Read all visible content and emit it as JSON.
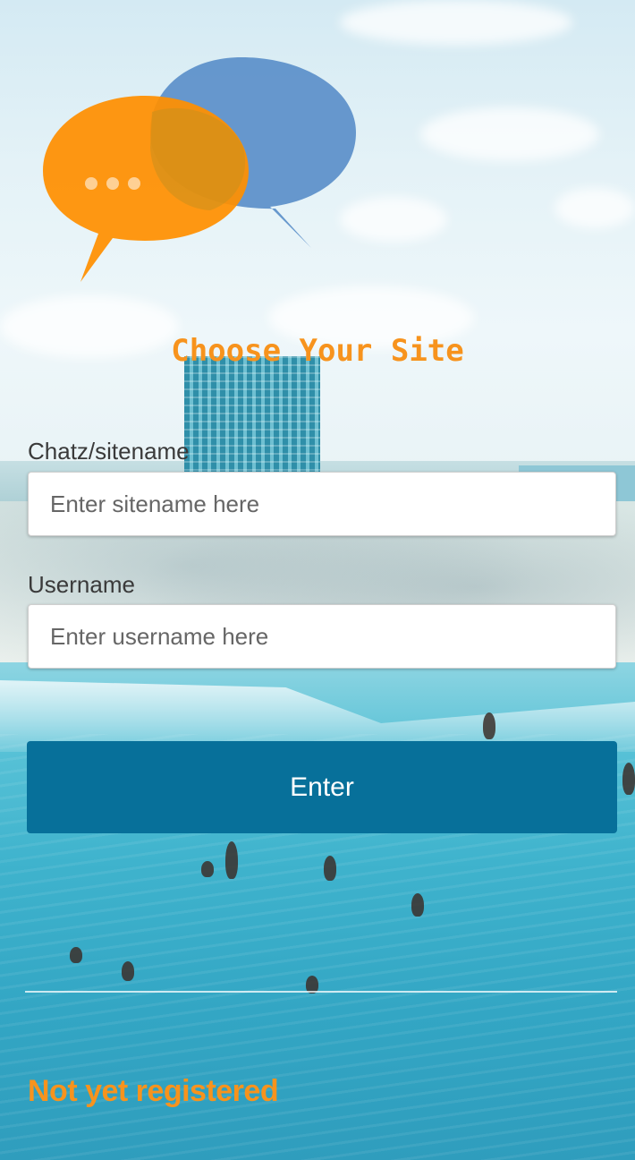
{
  "app": {
    "heading": "Choose Your Site"
  },
  "form": {
    "sitename": {
      "label": "Chatz/sitename",
      "placeholder": "Enter sitename here",
      "value": ""
    },
    "username": {
      "label": "Username",
      "placeholder": "Enter username here",
      "value": ""
    },
    "submit_label": "Enter"
  },
  "footer": {
    "register_link": "Not yet registered"
  },
  "icons": {
    "logo": "chat-bubbles-icon"
  },
  "colors": {
    "accent": "#f7931d",
    "button": "#07709a",
    "bubble_orange": "#ff8f00",
    "bubble_blue": "#5b8fc9"
  }
}
